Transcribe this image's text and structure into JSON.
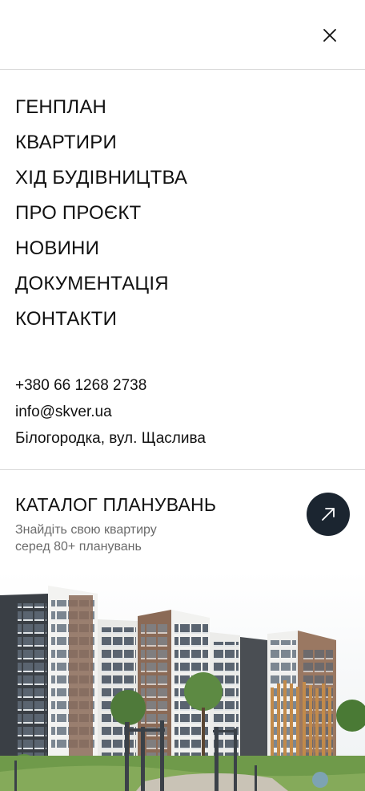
{
  "nav": {
    "items": [
      {
        "label": "ГЕНПЛАН"
      },
      {
        "label": "КВАРТИРИ"
      },
      {
        "label": "ХІД БУДІВНИЦТВА"
      },
      {
        "label": "ПРО ПРОЄКТ"
      },
      {
        "label": "НОВИНИ"
      },
      {
        "label": "ДОКУМЕНТАЦІЯ"
      },
      {
        "label": "КОНТАКТИ"
      }
    ]
  },
  "contacts": {
    "phone": "+380 66 1268 2738",
    "email": "info@skver.ua",
    "address": "Білогородка, вул. Щаслива"
  },
  "catalog": {
    "title": "КАТАЛОГ ПЛАНУВАНЬ",
    "subtitle_line1": "Знайдіть свою квартиру",
    "subtitle_line2": "серед 80+ планувань"
  },
  "icons": {
    "close": "close-icon",
    "arrow": "arrow-up-right-icon"
  },
  "colors": {
    "accent_dark": "#1b2530",
    "muted_text": "#6b6b6b",
    "divider": "#d9d9d9"
  }
}
